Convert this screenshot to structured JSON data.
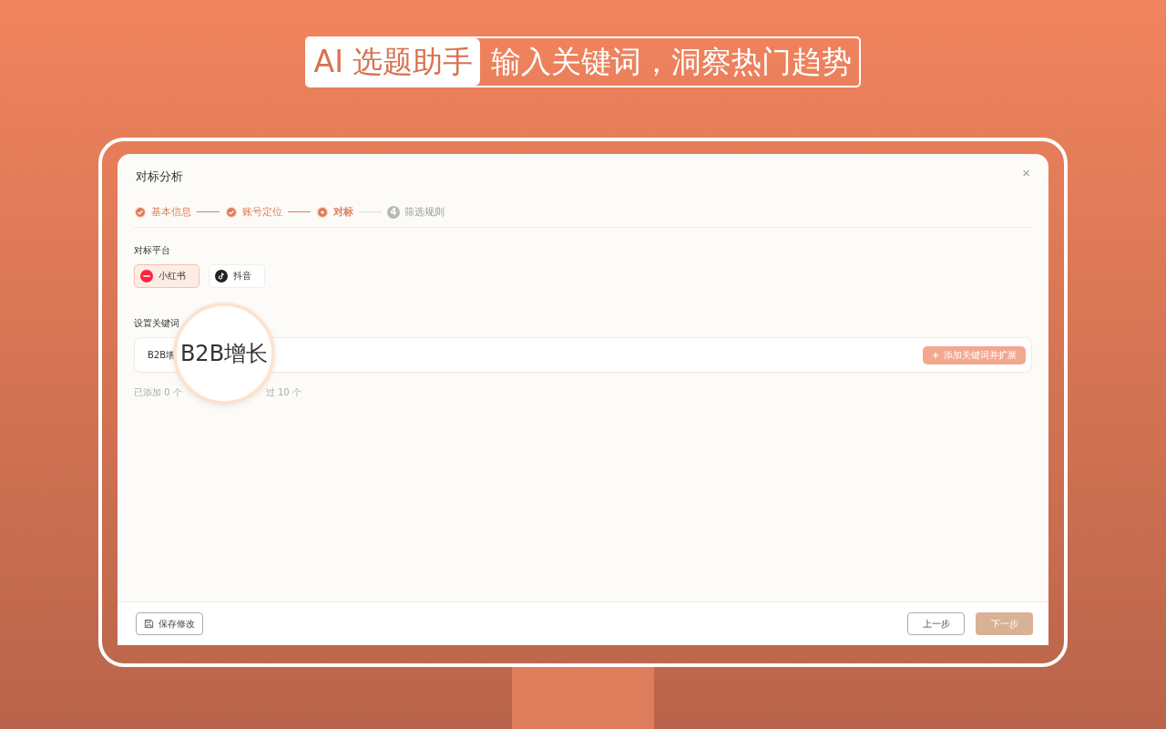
{
  "banner": {
    "tag": "AI 选题助手",
    "headline": "输入关键词，洞察热门趋势"
  },
  "dialog": {
    "title": "对标分析",
    "close": "×",
    "steps": [
      {
        "label": "基本信息",
        "completed": true,
        "selected": false
      },
      {
        "label": "账号定位",
        "completed": true,
        "selected": false
      },
      {
        "label": "对标",
        "completed": false,
        "selected": true
      },
      {
        "label": "筛选规则",
        "completed": false,
        "selected": false,
        "number": "4"
      }
    ],
    "platform_label": "对标平台",
    "platforms": [
      {
        "label": "小红书",
        "selected": true,
        "kind": "xhs"
      },
      {
        "label": "抖音",
        "selected": false,
        "kind": "douyin"
      }
    ],
    "keyword_label": "设置关键词",
    "keyword_value": "B2B增",
    "add_button": {
      "label": "添加关键词并扩展",
      "disabled": true
    },
    "hint_parts": [
      "已添加 0 个",
      "过 10 个"
    ],
    "magnifier": {
      "text": "B2B增长"
    },
    "footer": {
      "save": "保存修改",
      "prev": "上一步",
      "next": {
        "label": "下一步",
        "disabled": true
      }
    }
  }
}
